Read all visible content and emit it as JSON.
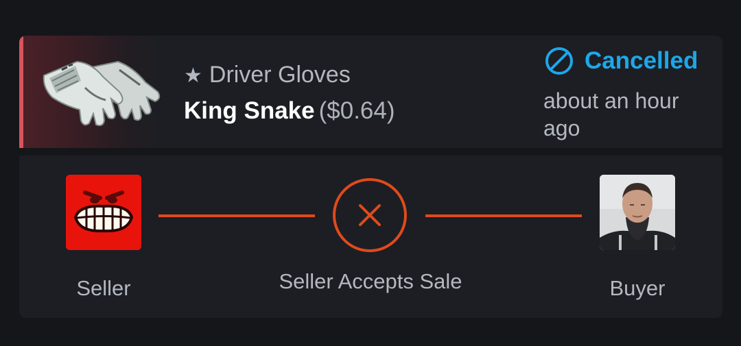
{
  "item": {
    "star": "★",
    "type": "Driver Gloves",
    "name": "King Snake",
    "price": "($0.64)"
  },
  "status": {
    "label": "Cancelled",
    "time": "about an hour ago",
    "icon": "cancelled-circle-icon",
    "color": "#1ea7e8"
  },
  "flow": {
    "seller_label": "Seller",
    "step_label": "Seller Accepts Sale",
    "buyer_label": "Buyer",
    "step_icon": "x-icon",
    "step_color": "#e04a1c"
  },
  "colors": {
    "accent": "#d9545d",
    "background": "#151619",
    "panel": "#1c1e23"
  }
}
